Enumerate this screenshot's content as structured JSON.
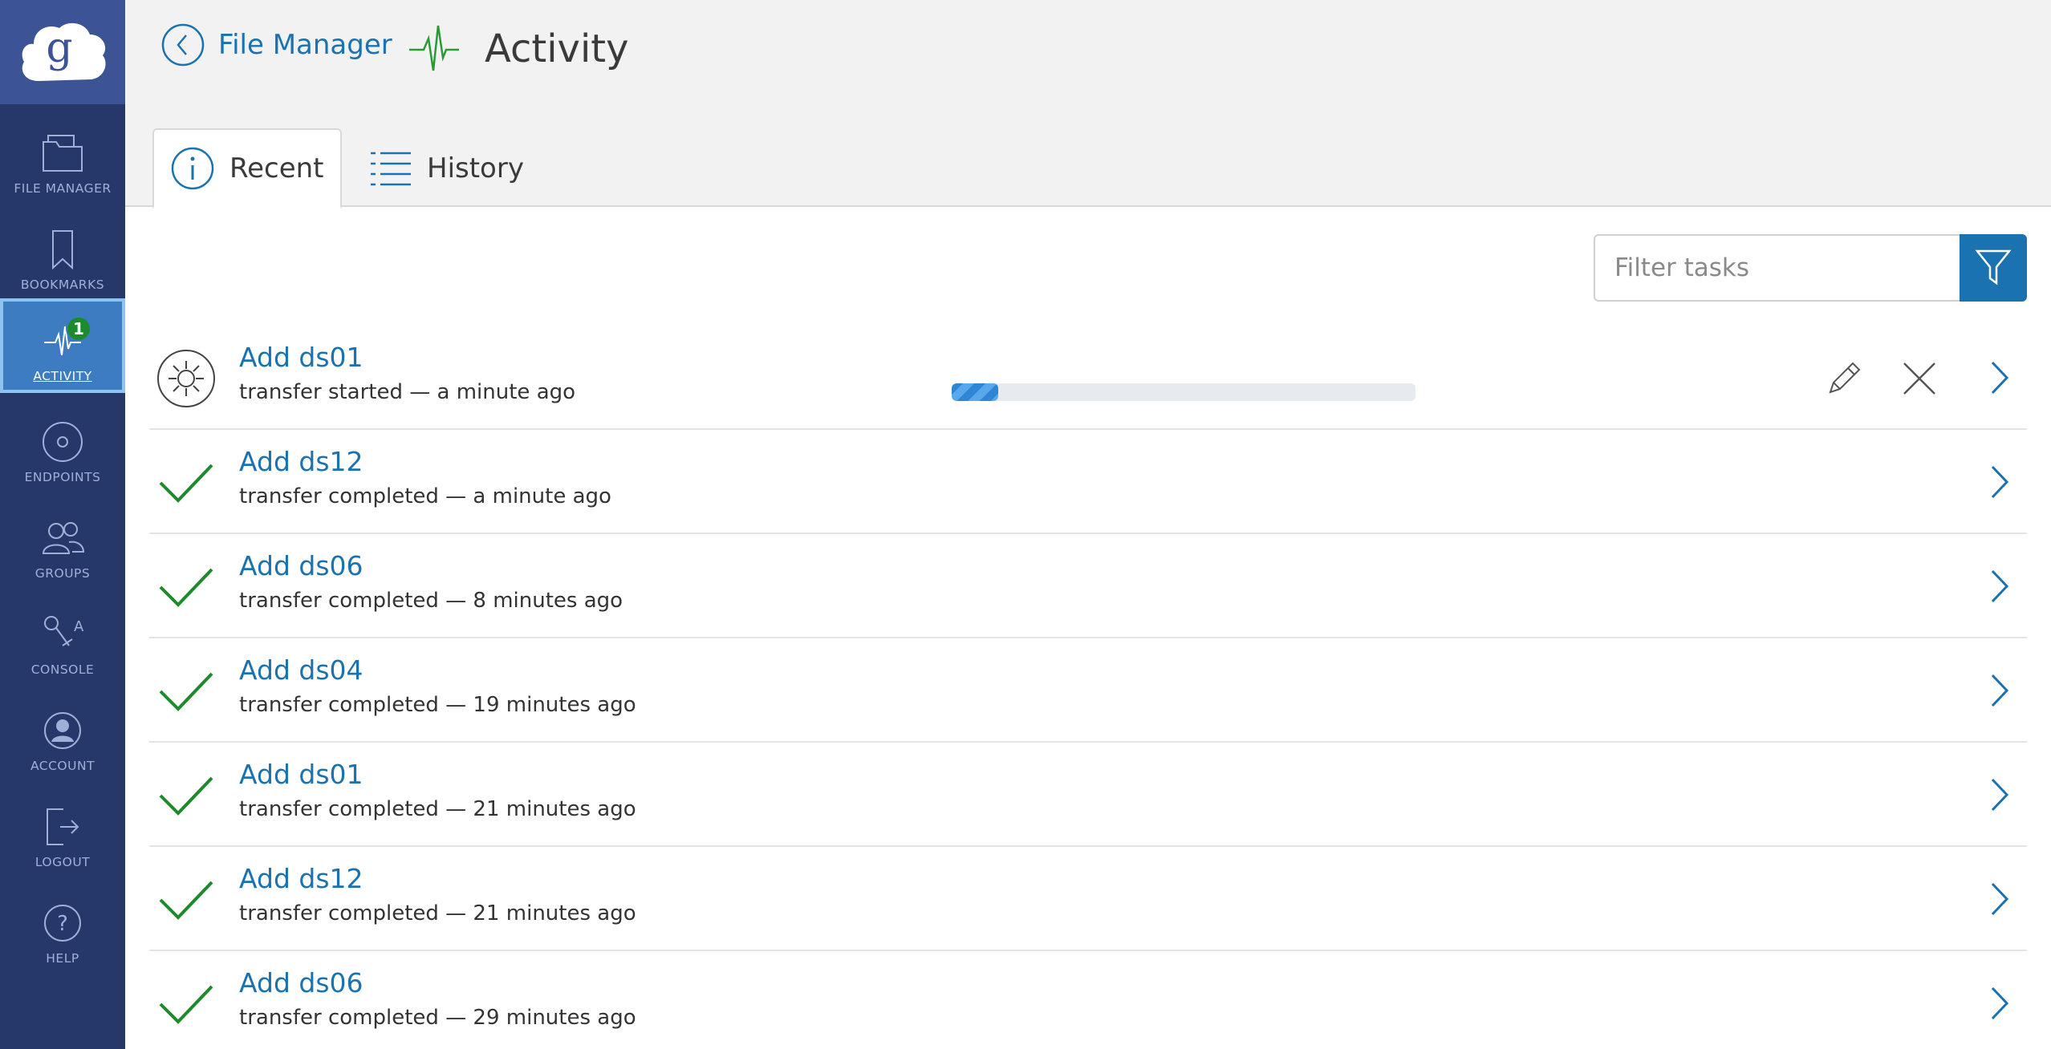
{
  "sidebar": {
    "items": [
      {
        "label": "FILE MANAGER",
        "icon": "folder-icon"
      },
      {
        "label": "BOOKMARKS",
        "icon": "bookmark-icon"
      },
      {
        "label": "ACTIVITY",
        "icon": "activity-icon",
        "badge": "1",
        "active": true
      },
      {
        "label": "ENDPOINTS",
        "icon": "endpoint-icon"
      },
      {
        "label": "GROUPS",
        "icon": "groups-icon"
      },
      {
        "label": "CONSOLE",
        "icon": "console-icon"
      },
      {
        "label": "ACCOUNT",
        "icon": "account-icon"
      },
      {
        "label": "LOGOUT",
        "icon": "logout-icon"
      },
      {
        "label": "HELP",
        "icon": "help-icon"
      }
    ]
  },
  "header": {
    "back_label": "File Manager",
    "title": "Activity",
    "tabs": [
      {
        "label": "Recent",
        "active": true
      },
      {
        "label": "History",
        "active": false
      }
    ]
  },
  "filter": {
    "placeholder": "Filter tasks"
  },
  "tasks": [
    {
      "title": "Add ds01",
      "status": "transfer started — a minute ago",
      "state": "active",
      "progress": 0.1
    },
    {
      "title": "Add ds12",
      "status": "transfer completed — a minute ago",
      "state": "completed"
    },
    {
      "title": "Add ds06",
      "status": "transfer completed — 8 minutes ago",
      "state": "completed"
    },
    {
      "title": "Add ds04",
      "status": "transfer completed — 19 minutes ago",
      "state": "completed"
    },
    {
      "title": "Add ds01",
      "status": "transfer completed — 21 minutes ago",
      "state": "completed"
    },
    {
      "title": "Add ds12",
      "status": "transfer completed — 21 minutes ago",
      "state": "completed"
    },
    {
      "title": "Add ds06",
      "status": "transfer completed — 29 minutes ago",
      "state": "completed"
    }
  ],
  "colors": {
    "sidebar_bg": "#26386a",
    "logo_bg": "#3c5396",
    "active_nav": "#3d7cc0",
    "link_blue": "#1b72b0",
    "success_green": "#1d8a2c",
    "activity_green": "#2a9a35"
  }
}
